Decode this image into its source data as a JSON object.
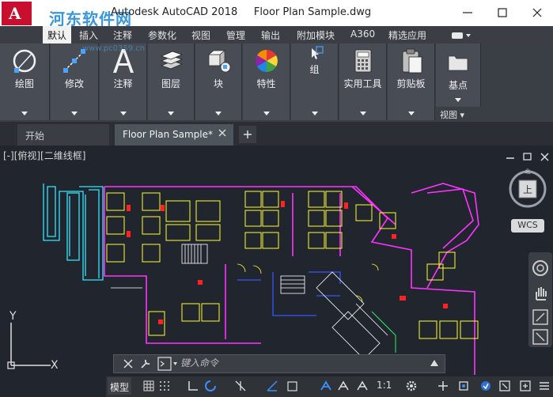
{
  "titlebar": {
    "app_logo": "A",
    "watermark": "河东软件网",
    "watermark_url": "www.pc0359.cn",
    "title": "Autodesk AutoCAD 2018     Floor Plan Sample.dwg",
    "minimize_icon": "minimize-icon",
    "maximize_icon": "maximize-icon",
    "close_icon": "close-icon"
  },
  "ribbon_tabs": [
    {
      "label": "默认",
      "active": true
    },
    {
      "label": "插入"
    },
    {
      "label": "注释"
    },
    {
      "label": "参数化"
    },
    {
      "label": "视图"
    },
    {
      "label": "管理"
    },
    {
      "label": "输出"
    },
    {
      "label": "附加模块"
    },
    {
      "label": "A360"
    },
    {
      "label": "精选应用"
    }
  ],
  "ribbon_panels": [
    {
      "label": "绘图",
      "icon": "draw-icon"
    },
    {
      "label": "修改",
      "icon": "modify-icon"
    },
    {
      "label": "注释",
      "icon": "annotation-icon"
    },
    {
      "label": "图层",
      "icon": "layers-icon"
    },
    {
      "label": "块",
      "icon": "block-icon"
    },
    {
      "label": "特性",
      "icon": "properties-icon"
    },
    {
      "label": "组",
      "icon": "group-icon"
    },
    {
      "label": "实用工具",
      "icon": "calculator-icon"
    },
    {
      "label": "剪贴板",
      "icon": "clipboard-icon"
    },
    {
      "label": "基点",
      "icon": "base-point-icon"
    }
  ],
  "view_panel_label": "视图 ▾",
  "doc_tabs": {
    "start": "开始",
    "current": "Floor Plan Sample*",
    "new_tab": "+"
  },
  "viewport": {
    "controls": "[-][俯视][二维线框]",
    "viewcube_face": "上",
    "wcs_label": "WCS",
    "ucs_x": "X",
    "ucs_y": "Y"
  },
  "command_line": {
    "placeholder": "键入命令"
  },
  "statusbar": {
    "model": "模型",
    "scale": "1:1"
  },
  "colors": {
    "accent": "#c8102e",
    "ribbon_bg": "#3a3f46",
    "viewport_bg": "#21262e",
    "walls": "#ff33ff",
    "furniture": "#ffff33",
    "stairs": "#ffffff",
    "cyan_lines": "#33e6ff",
    "dimension_red": "#ff2222"
  }
}
